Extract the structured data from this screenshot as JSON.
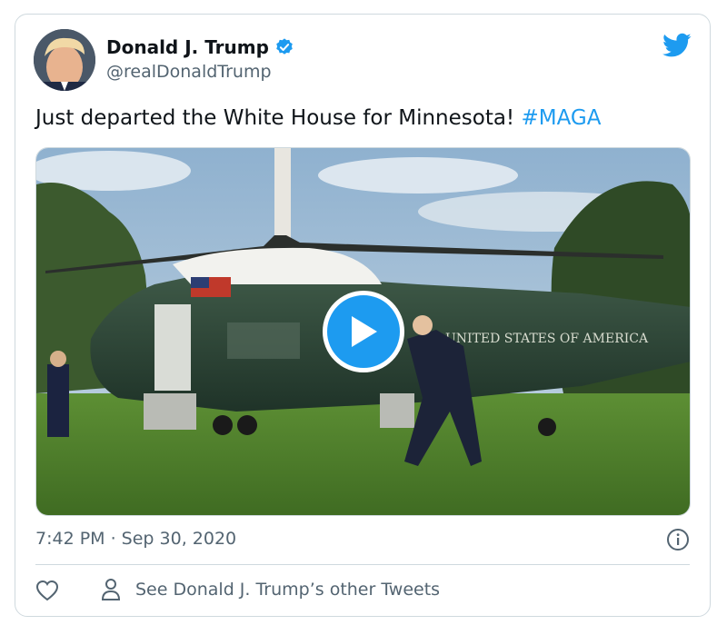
{
  "author": {
    "name": "Donald J. Trump",
    "handle": "@realDonaldTrump"
  },
  "tweet": {
    "text": "Just departed the White House for Minnesota! ",
    "hashtag": "#MAGA"
  },
  "media": {
    "helicopter_text": "UNITED STATES OF AMERICA"
  },
  "meta": {
    "timestamp": "7:42 PM · Sep 30, 2020"
  },
  "actions": {
    "other_tweets_label": "See Donald J. Trump’s other Tweets"
  },
  "colors": {
    "accent": "#1d9bf0",
    "text_primary": "#0f1419",
    "text_secondary": "#536471",
    "border": "#cfd9de"
  },
  "icons": [
    "avatar",
    "verified-badge-icon",
    "twitter-bird-icon",
    "play-icon",
    "info-icon",
    "heart-icon",
    "person-icon"
  ]
}
